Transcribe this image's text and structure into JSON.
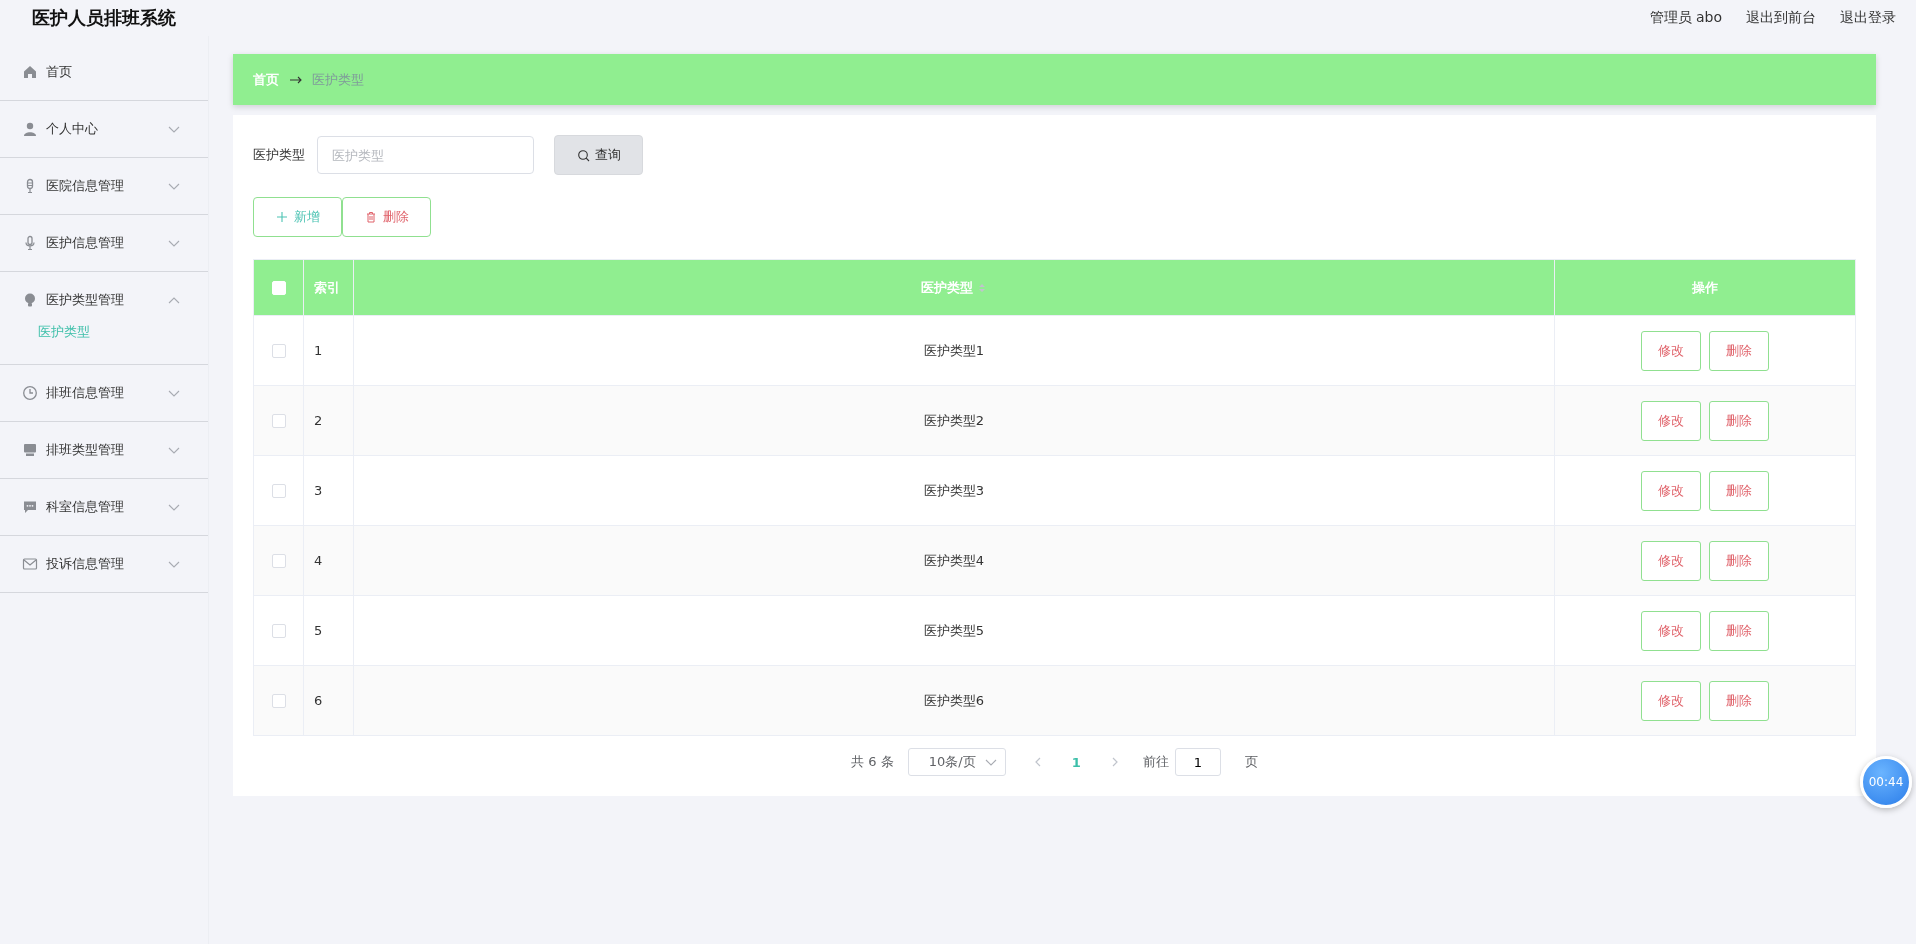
{
  "app_title": "医护人员排班系统",
  "header_links": [
    {
      "label": "管理员 abo"
    },
    {
      "label": "退出到前台"
    },
    {
      "label": "退出登录"
    }
  ],
  "sidebar": {
    "items": [
      {
        "kind": "link",
        "label": "首页"
      },
      {
        "kind": "group",
        "label": "个人中心",
        "expanded": false
      },
      {
        "kind": "group",
        "label": "医院信息管理",
        "expanded": false
      },
      {
        "kind": "group",
        "label": "医护信息管理",
        "expanded": false
      },
      {
        "kind": "group",
        "label": "医护类型管理",
        "expanded": true,
        "children": [
          {
            "label": "医护类型",
            "selected": true
          }
        ]
      },
      {
        "kind": "group",
        "label": "排班信息管理",
        "expanded": false
      },
      {
        "kind": "group",
        "label": "排班类型管理",
        "expanded": false
      },
      {
        "kind": "group",
        "label": "科室信息管理",
        "expanded": false
      },
      {
        "kind": "group",
        "label": "投诉信息管理",
        "expanded": false
      }
    ]
  },
  "breadcrumb": [
    {
      "label": "首页"
    },
    {
      "label": "医护类型"
    }
  ],
  "search": {
    "label": "医护类型",
    "placeholder": "医护类型",
    "button": "查询"
  },
  "actions": [
    {
      "kind": "add",
      "label": "新增"
    },
    {
      "kind": "delete",
      "label": "删除"
    }
  ],
  "table": {
    "select_all": {
      "checked": false
    },
    "columns": [
      {
        "label": "索引"
      },
      {
        "label": "医护类型",
        "sortable": true
      },
      {
        "label": "操作"
      }
    ],
    "rows": [
      {
        "checked": false,
        "index": "1",
        "type": "医护类型1",
        "edit": "修改",
        "delete": "删除"
      },
      {
        "checked": false,
        "index": "2",
        "type": "医护类型2",
        "edit": "修改",
        "delete": "删除"
      },
      {
        "checked": false,
        "index": "3",
        "type": "医护类型3",
        "edit": "修改",
        "delete": "删除"
      },
      {
        "checked": false,
        "index": "4",
        "type": "医护类型4",
        "edit": "修改",
        "delete": "删除"
      },
      {
        "checked": false,
        "index": "5",
        "type": "医护类型5",
        "edit": "修改",
        "delete": "删除"
      },
      {
        "checked": false,
        "index": "6",
        "type": "医护类型6",
        "edit": "修改",
        "delete": "删除"
      }
    ]
  },
  "pagination": {
    "total": "共 6 条",
    "page_size": "10条/页",
    "pages": [
      {
        "label": "1",
        "selected": true
      }
    ],
    "goto_label": "前往",
    "goto_value": "1",
    "goto_suffix": "页"
  },
  "timer": {
    "label": "00:44"
  }
}
